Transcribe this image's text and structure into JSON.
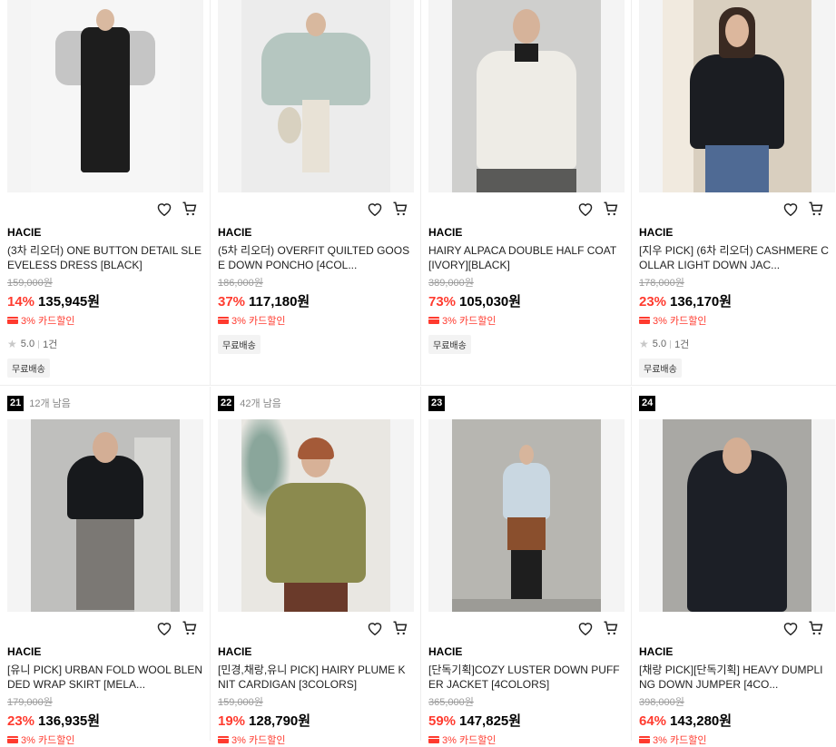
{
  "icons": {
    "wishlist": "heart-icon",
    "cart": "cart-icon",
    "card": "credit-card-icon",
    "star": "star-icon"
  },
  "colors": {
    "discount": "#ff3b2f",
    "rank_bg": "#000000"
  },
  "products": [
    {
      "brand": "HACIE",
      "title": "(3차 리오더) ONE BUTTON DETAIL SLEEVELESS DRESS [BLACK]",
      "original_price": "159,000원",
      "discount": "14%",
      "price": "135,945원",
      "card_discount": "3% 카드할인",
      "rating": "5.0",
      "reviews": "1건",
      "tag": "무료배송"
    },
    {
      "brand": "HACIE",
      "title": "(5차 리오더) OVERFIT QUILTED GOOSE DOWN PONCHO [4COL...",
      "original_price": "186,000원",
      "discount": "37%",
      "price": "117,180원",
      "card_discount": "3% 카드할인",
      "tag": "무료배송"
    },
    {
      "brand": "HACIE",
      "title": "HAIRY ALPACA DOUBLE HALF COAT [IVORY][BLACK]",
      "original_price": "389,000원",
      "discount": "73%",
      "price": "105,030원",
      "card_discount": "3% 카드할인",
      "tag": "무료배송"
    },
    {
      "brand": "HACIE",
      "title": "[지우 PICK] (6차 리오더) CASHMERE COLLAR LIGHT DOWN JAC...",
      "original_price": "178,000원",
      "discount": "23%",
      "price": "136,170원",
      "card_discount": "3% 카드할인",
      "rating": "5.0",
      "reviews": "1건",
      "tag": "무료배송"
    },
    {
      "rank": "21",
      "stock": "12개 남음",
      "brand": "HACIE",
      "title": "[유니 PICK] URBAN FOLD WOOL BLENDED WRAP SKIRT [MELA...",
      "original_price": "179,000원",
      "discount": "23%",
      "price": "136,935원",
      "card_discount": "3% 카드할인"
    },
    {
      "rank": "22",
      "stock": "42개 남음",
      "brand": "HACIE",
      "title": "[민경,채랑,유니 PICK] HAIRY PLUME KNIT CARDIGAN [3COLORS]",
      "original_price": "159,000원",
      "discount": "19%",
      "price": "128,790원",
      "card_discount": "3% 카드할인"
    },
    {
      "rank": "23",
      "brand": "HACIE",
      "title": "[단독기획]COZY LUSTER DOWN PUFFER JACKET [4COLORS]",
      "original_price": "365,000원",
      "discount": "59%",
      "price": "147,825원",
      "card_discount": "3% 카드할인"
    },
    {
      "rank": "24",
      "brand": "HACIE",
      "title": "[채랑 PICK][단독기획] HEAVY DUMPLING DOWN JUMPER [4CO...",
      "original_price": "398,000원",
      "discount": "64%",
      "price": "143,280원",
      "card_discount": "3% 카드할인"
    }
  ]
}
